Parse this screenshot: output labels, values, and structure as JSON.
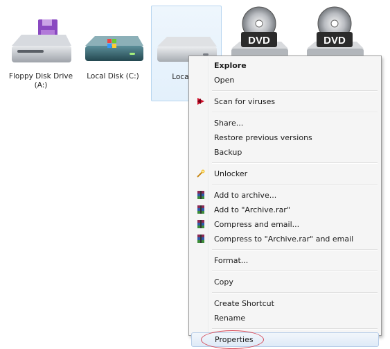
{
  "drives": [
    {
      "label": "Floppy Disk Drive (A:)",
      "icon": "floppy-drive-icon"
    },
    {
      "label": "Local Disk (C:)",
      "icon": "system-drive-icon"
    },
    {
      "label": "Local Di",
      "icon": "hard-drive-icon"
    },
    {
      "label": "",
      "icon": "dvd-drive-icon",
      "badge": "DVD"
    },
    {
      "label": "",
      "icon": "dvd-drive-icon",
      "badge": "DVD"
    }
  ],
  "menu": {
    "explore": "Explore",
    "open": "Open",
    "scan": "Scan for viruses",
    "share": "Share...",
    "restore": "Restore previous versions",
    "backup": "Backup",
    "unlocker": "Unlocker",
    "add_archive": "Add to archive...",
    "add_archive_rar": "Add to \"Archive.rar\"",
    "compress_email": "Compress and email...",
    "compress_rar_email": "Compress to \"Archive.rar\" and email",
    "format": "Format...",
    "copy": "Copy",
    "create_shortcut": "Create Shortcut",
    "rename": "Rename",
    "properties": "Properties"
  },
  "colors": {
    "highlight_ellipse": "#d64b5a",
    "scan_icon": "#d0102a",
    "winrar_icon": "#8a2a55"
  }
}
